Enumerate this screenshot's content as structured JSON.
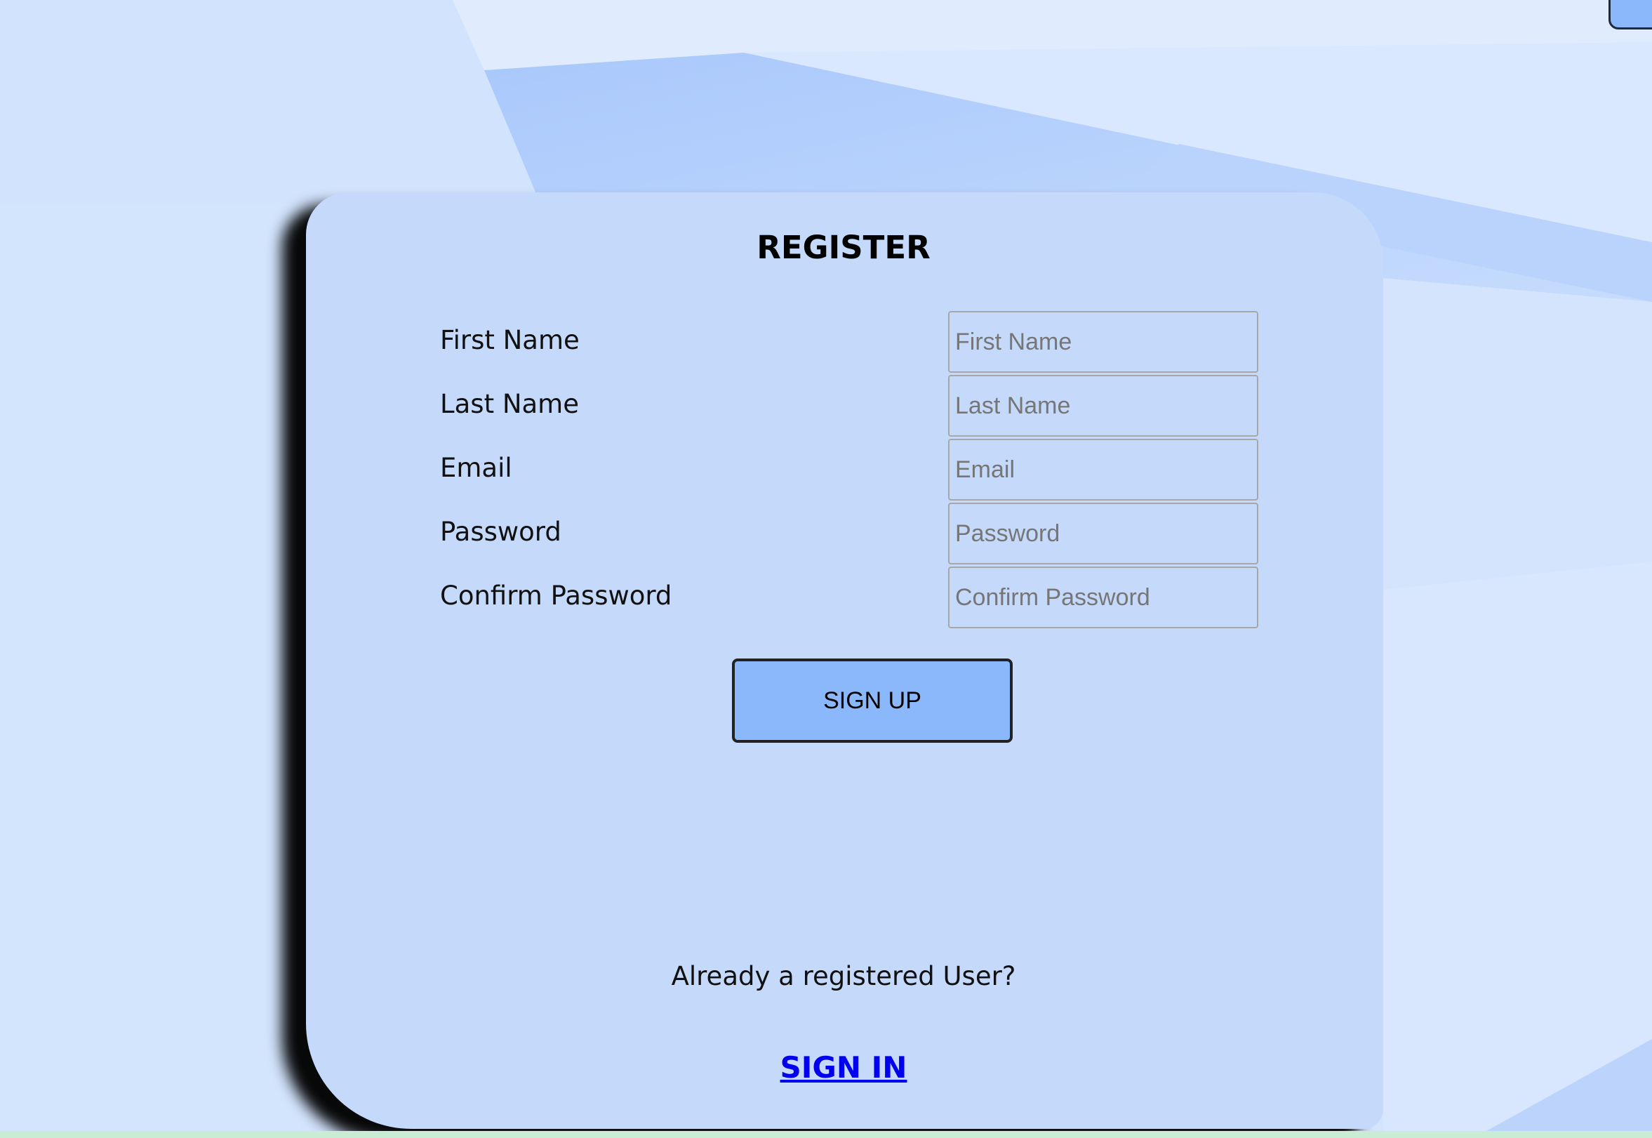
{
  "form": {
    "title": "REGISTER",
    "fields": [
      {
        "label": "First Name",
        "placeholder": "First Name"
      },
      {
        "label": "Last Name",
        "placeholder": "Last Name"
      },
      {
        "label": "Email",
        "placeholder": "Email"
      },
      {
        "label": "Password",
        "placeholder": "Password"
      },
      {
        "label": "Confirm Password",
        "placeholder": "Confirm Password"
      }
    ],
    "submit_label": "SIGN UP",
    "already_text": "Already a registered User?",
    "signin_label": "SIGN IN"
  },
  "colors": {
    "background": "#d6e6fd",
    "card": "#c5d9fb",
    "button": "#8ab8fb",
    "link": "#0000ee"
  }
}
